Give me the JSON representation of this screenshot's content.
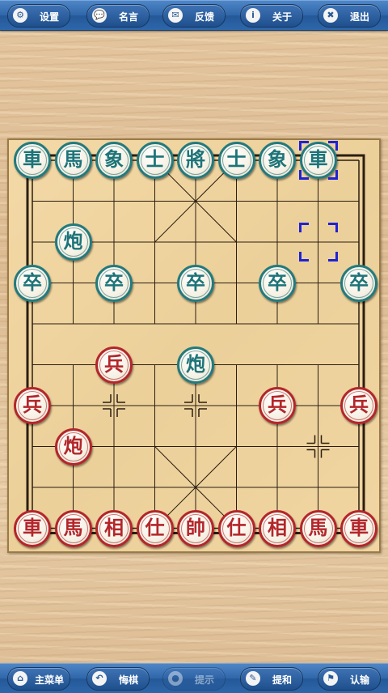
{
  "top_bar": {
    "buttons": [
      {
        "label": "设置",
        "icon": "gear-icon",
        "glyph": "⚙"
      },
      {
        "label": "名言",
        "icon": "speech-bubble-icon",
        "glyph": "💬"
      },
      {
        "label": "反馈",
        "icon": "envelope-icon",
        "glyph": "✉"
      },
      {
        "label": "关于",
        "icon": "info-icon",
        "glyph": "i"
      },
      {
        "label": "退出",
        "icon": "close-icon",
        "glyph": "✖"
      }
    ]
  },
  "bottom_bar": {
    "buttons": [
      {
        "label": "主菜单",
        "icon": "home-icon",
        "glyph": "⌂",
        "enabled": true
      },
      {
        "label": "悔棋",
        "icon": "undo-icon",
        "glyph": "↶",
        "enabled": true
      },
      {
        "label": "提示",
        "icon": "lightbulb-icon",
        "glyph": "●",
        "enabled": false
      },
      {
        "label": "提和",
        "icon": "pencil-icon",
        "glyph": "✎",
        "enabled": true
      },
      {
        "label": "认输",
        "icon": "flag-icon",
        "glyph": "⚑",
        "enabled": true
      }
    ]
  },
  "board": {
    "columns": 9,
    "rows": 10,
    "colors": {
      "red": "#b3262a",
      "black": "#237a7d",
      "selection": "#1d22d6",
      "line": "#2b1e10"
    },
    "pieces": [
      {
        "char": "車",
        "side": "black",
        "col": 0,
        "row": 0
      },
      {
        "char": "馬",
        "side": "black",
        "col": 1,
        "row": 0
      },
      {
        "char": "象",
        "side": "black",
        "col": 2,
        "row": 0
      },
      {
        "char": "士",
        "side": "black",
        "col": 3,
        "row": 0
      },
      {
        "char": "將",
        "side": "black",
        "col": 4,
        "row": 0
      },
      {
        "char": "士",
        "side": "black",
        "col": 5,
        "row": 0
      },
      {
        "char": "象",
        "side": "black",
        "col": 6,
        "row": 0
      },
      {
        "char": "車",
        "side": "black",
        "col": 7,
        "row": 0
      },
      {
        "char": "炮",
        "side": "black",
        "col": 1,
        "row": 2
      },
      {
        "char": "卒",
        "side": "black",
        "col": 0,
        "row": 3
      },
      {
        "char": "卒",
        "side": "black",
        "col": 2,
        "row": 3
      },
      {
        "char": "卒",
        "side": "black",
        "col": 4,
        "row": 3
      },
      {
        "char": "卒",
        "side": "black",
        "col": 6,
        "row": 3
      },
      {
        "char": "卒",
        "side": "black",
        "col": 8,
        "row": 3
      },
      {
        "char": "炮",
        "side": "black",
        "col": 4,
        "row": 5
      },
      {
        "char": "兵",
        "side": "red",
        "col": 2,
        "row": 5
      },
      {
        "char": "兵",
        "side": "red",
        "col": 0,
        "row": 6
      },
      {
        "char": "兵",
        "side": "red",
        "col": 6,
        "row": 6
      },
      {
        "char": "兵",
        "side": "red",
        "col": 8,
        "row": 6
      },
      {
        "char": "炮",
        "side": "red",
        "col": 1,
        "row": 7
      },
      {
        "char": "車",
        "side": "red",
        "col": 0,
        "row": 9
      },
      {
        "char": "馬",
        "side": "red",
        "col": 1,
        "row": 9
      },
      {
        "char": "相",
        "side": "red",
        "col": 2,
        "row": 9
      },
      {
        "char": "仕",
        "side": "red",
        "col": 3,
        "row": 9
      },
      {
        "char": "帥",
        "side": "red",
        "col": 4,
        "row": 9
      },
      {
        "char": "仕",
        "side": "red",
        "col": 5,
        "row": 9
      },
      {
        "char": "相",
        "side": "red",
        "col": 6,
        "row": 9
      },
      {
        "char": "馬",
        "side": "red",
        "col": 7,
        "row": 9
      },
      {
        "char": "車",
        "side": "red",
        "col": 8,
        "row": 9
      }
    ],
    "last_move": {
      "from": {
        "col": 7,
        "row": 2
      },
      "to": {
        "col": 7,
        "row": 0
      }
    },
    "position_markers": [
      {
        "col": 2,
        "row": 6
      },
      {
        "col": 4,
        "row": 6
      },
      {
        "col": 7,
        "row": 7
      }
    ]
  }
}
